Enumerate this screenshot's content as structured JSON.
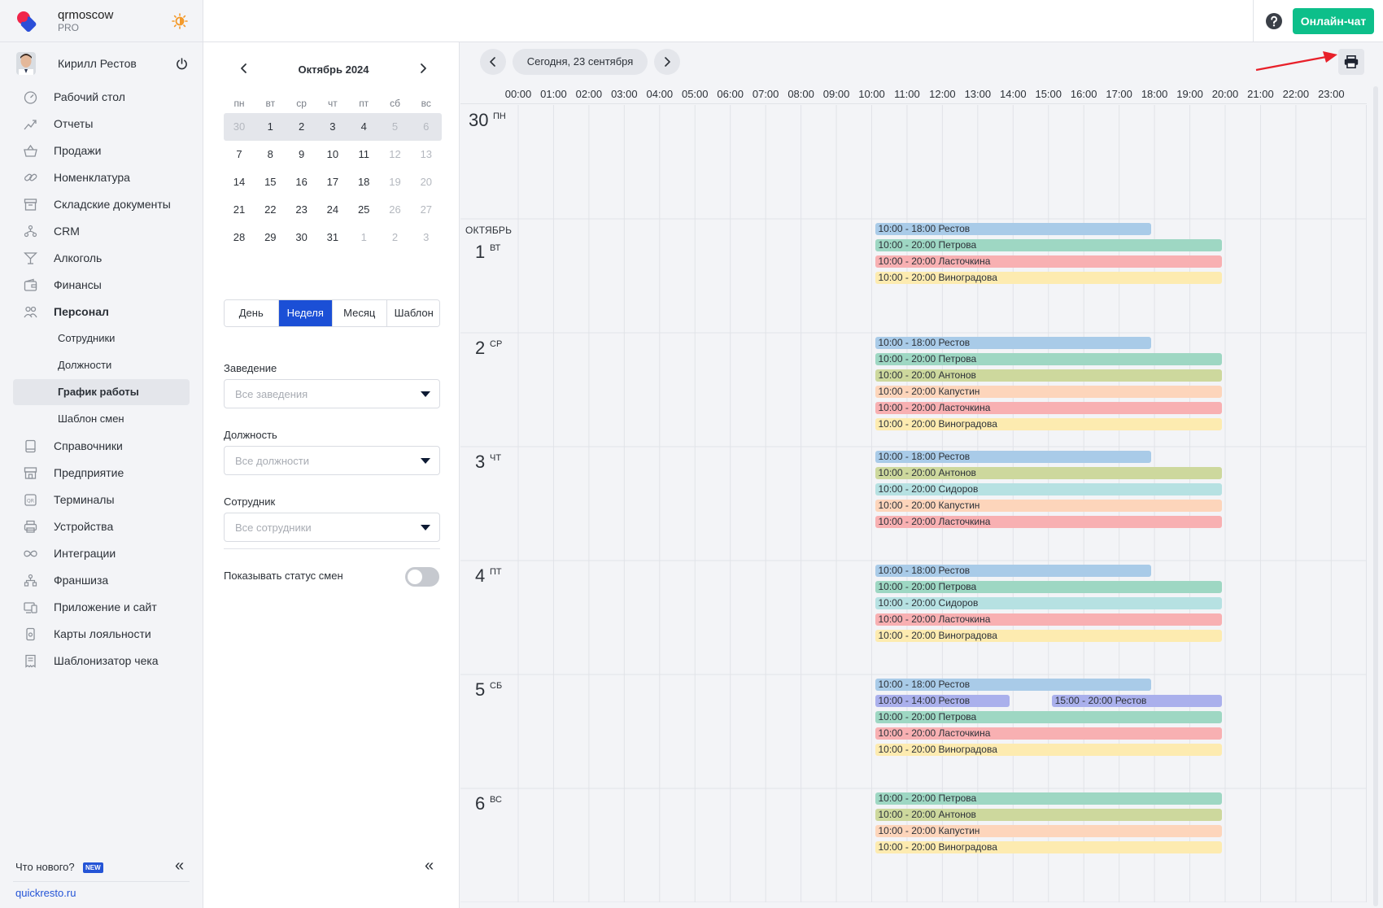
{
  "brand": {
    "name": "qrmoscow",
    "plan": "PRO"
  },
  "user": {
    "name": "Кирилл Рестов"
  },
  "nav": [
    {
      "label": "Рабочий стол",
      "icon": "dashboard-icon",
      "sub": false
    },
    {
      "label": "Отчеты",
      "icon": "reports-icon",
      "sub": false
    },
    {
      "label": "Продажи",
      "icon": "sales-basket-icon",
      "sub": false
    },
    {
      "label": "Номенклатура",
      "icon": "link-icon",
      "sub": false
    },
    {
      "label": "Складские документы",
      "icon": "warehouse-icon",
      "sub": false
    },
    {
      "label": "CRM",
      "icon": "crm-people-icon",
      "sub": false
    },
    {
      "label": "Алкоголь",
      "icon": "cocktail-icon",
      "sub": false
    },
    {
      "label": "Финансы",
      "icon": "wallet-icon",
      "sub": false
    },
    {
      "label": "Персонал",
      "icon": "staff-icon",
      "sub": false,
      "bold": true
    },
    {
      "label": "Сотрудники",
      "sub": true
    },
    {
      "label": "Должности",
      "sub": true
    },
    {
      "label": "График работы",
      "sub": true,
      "active": true
    },
    {
      "label": "Шаблон смен",
      "sub": true
    },
    {
      "label": "Справочники",
      "icon": "book-icon",
      "sub": false
    },
    {
      "label": "Предприятие",
      "icon": "store-icon",
      "sub": false
    },
    {
      "label": "Терминалы",
      "icon": "terminal-icon",
      "sub": false
    },
    {
      "label": "Устройства",
      "icon": "printer-device-icon",
      "sub": false
    },
    {
      "label": "Интеграции",
      "icon": "infinity-icon",
      "sub": false
    },
    {
      "label": "Франшиза",
      "icon": "franchise-icon",
      "sub": false
    },
    {
      "label": "Приложение и сайт",
      "icon": "app-site-icon",
      "sub": false
    },
    {
      "label": "Карты лояльности",
      "icon": "loyalty-card-icon",
      "sub": false
    },
    {
      "label": "Шаблонизатор чека",
      "icon": "receipt-icon",
      "sub": false
    }
  ],
  "footer": {
    "whats_new": "Что нового?",
    "badge": "NEW",
    "site": "quickresto.ru"
  },
  "topbar": {
    "chat_label": "Онлайн-чат"
  },
  "calendar": {
    "title": "Октябрь 2024",
    "weekdays": [
      "пн",
      "вт",
      "ср",
      "чт",
      "пт",
      "сб",
      "вс"
    ],
    "weeks": [
      [
        {
          "d": "30",
          "m": true
        },
        {
          "d": "1"
        },
        {
          "d": "2"
        },
        {
          "d": "3"
        },
        {
          "d": "4"
        },
        {
          "d": "5",
          "m": true
        },
        {
          "d": "6",
          "m": true
        }
      ],
      [
        {
          "d": "7"
        },
        {
          "d": "8"
        },
        {
          "d": "9"
        },
        {
          "d": "10"
        },
        {
          "d": "11"
        },
        {
          "d": "12",
          "m": true
        },
        {
          "d": "13",
          "m": true
        }
      ],
      [
        {
          "d": "14"
        },
        {
          "d": "15"
        },
        {
          "d": "16"
        },
        {
          "d": "17"
        },
        {
          "d": "18"
        },
        {
          "d": "19",
          "m": true
        },
        {
          "d": "20",
          "m": true
        }
      ],
      [
        {
          "d": "21"
        },
        {
          "d": "22"
        },
        {
          "d": "23"
        },
        {
          "d": "24"
        },
        {
          "d": "25"
        },
        {
          "d": "26",
          "m": true
        },
        {
          "d": "27",
          "m": true
        }
      ],
      [
        {
          "d": "28"
        },
        {
          "d": "29"
        },
        {
          "d": "30"
        },
        {
          "d": "31"
        },
        {
          "d": "1",
          "m": true
        },
        {
          "d": "2",
          "m": true
        },
        {
          "d": "3",
          "m": true
        }
      ]
    ]
  },
  "view_tabs": [
    {
      "label": "День"
    },
    {
      "label": "Неделя",
      "active": true
    },
    {
      "label": "Месяц"
    },
    {
      "label": "Шаблон"
    }
  ],
  "filters": {
    "venue_label": "Заведение",
    "venue_placeholder": "Все заведения",
    "position_label": "Должность",
    "position_placeholder": "Все должности",
    "employee_label": "Сотрудник",
    "employee_placeholder": "Все сотрудники",
    "show_status_label": "Показывать статус смен",
    "show_status": false
  },
  "schedule": {
    "today_label": "Сегодня, 23 сентября",
    "hours": [
      "00:00",
      "01:00",
      "02:00",
      "03:00",
      "04:00",
      "05:00",
      "06:00",
      "07:00",
      "08:00",
      "09:00",
      "10:00",
      "11:00",
      "12:00",
      "13:00",
      "14:00",
      "15:00",
      "16:00",
      "17:00",
      "18:00",
      "19:00",
      "20:00",
      "21:00",
      "22:00",
      "23:00"
    ],
    "colors": {
      "Рестов": "#a9cbe8",
      "Рестов2": "#aab0ec",
      "Петрова": "#9ed7c3",
      "Ласточкина": "#f8b0b2",
      "Виноградова": "#fdebb0",
      "Антонов": "#cdd89d",
      "Капустин": "#fdd5bb",
      "Сидоров": "#b6e1e2"
    },
    "days": [
      {
        "num": "30",
        "wd": "ПН",
        "month": "",
        "shifts": []
      },
      {
        "num": "1",
        "wd": "ВТ",
        "month": "ОКТЯБРЬ",
        "shifts": [
          {
            "label": "10:00 - 18:00 Рестов",
            "start": 10,
            "end": 18,
            "color": "Рестов",
            "row": 0
          },
          {
            "label": "10:00 - 20:00 Петрова",
            "start": 10,
            "end": 20,
            "color": "Петрова",
            "row": 1
          },
          {
            "label": "10:00 - 20:00 Ласточкина",
            "start": 10,
            "end": 20,
            "color": "Ласточкина",
            "row": 2
          },
          {
            "label": "10:00 - 20:00 Виноградова",
            "start": 10,
            "end": 20,
            "color": "Виноградова",
            "row": 3
          }
        ]
      },
      {
        "num": "2",
        "wd": "СР",
        "month": "",
        "shifts": [
          {
            "label": "10:00 - 18:00 Рестов",
            "start": 10,
            "end": 18,
            "color": "Рестов",
            "row": 0
          },
          {
            "label": "10:00 - 20:00 Петрова",
            "start": 10,
            "end": 20,
            "color": "Петрова",
            "row": 1
          },
          {
            "label": "10:00 - 20:00 Антонов",
            "start": 10,
            "end": 20,
            "color": "Антонов",
            "row": 2
          },
          {
            "label": "10:00 - 20:00 Капустин",
            "start": 10,
            "end": 20,
            "color": "Капустин",
            "row": 3
          },
          {
            "label": "10:00 - 20:00 Ласточкина",
            "start": 10,
            "end": 20,
            "color": "Ласточкина",
            "row": 4
          },
          {
            "label": "10:00 - 20:00 Виноградова",
            "start": 10,
            "end": 20,
            "color": "Виноградова",
            "row": 5
          }
        ]
      },
      {
        "num": "3",
        "wd": "ЧТ",
        "month": "",
        "shifts": [
          {
            "label": "10:00 - 18:00 Рестов",
            "start": 10,
            "end": 18,
            "color": "Рестов",
            "row": 0
          },
          {
            "label": "10:00 - 20:00 Антонов",
            "start": 10,
            "end": 20,
            "color": "Антонов",
            "row": 1
          },
          {
            "label": "10:00 - 20:00 Сидоров",
            "start": 10,
            "end": 20,
            "color": "Сидоров",
            "row": 2
          },
          {
            "label": "10:00 - 20:00 Капустин",
            "start": 10,
            "end": 20,
            "color": "Капустин",
            "row": 3
          },
          {
            "label": "10:00 - 20:00 Ласточкина",
            "start": 10,
            "end": 20,
            "color": "Ласточкина",
            "row": 4
          }
        ]
      },
      {
        "num": "4",
        "wd": "ПТ",
        "month": "",
        "shifts": [
          {
            "label": "10:00 - 18:00 Рестов",
            "start": 10,
            "end": 18,
            "color": "Рестов",
            "row": 0
          },
          {
            "label": "10:00 - 20:00 Петрова",
            "start": 10,
            "end": 20,
            "color": "Петрова",
            "row": 1
          },
          {
            "label": "10:00 - 20:00 Сидоров",
            "start": 10,
            "end": 20,
            "color": "Сидоров",
            "row": 2
          },
          {
            "label": "10:00 - 20:00 Ласточкина",
            "start": 10,
            "end": 20,
            "color": "Ласточкина",
            "row": 3
          },
          {
            "label": "10:00 - 20:00 Виноградова",
            "start": 10,
            "end": 20,
            "color": "Виноградова",
            "row": 4
          }
        ]
      },
      {
        "num": "5",
        "wd": "СБ",
        "month": "",
        "shifts": [
          {
            "label": "10:00 - 18:00 Рестов",
            "start": 10,
            "end": 18,
            "color": "Рестов",
            "row": 0
          },
          {
            "label": "10:00 - 14:00 Рестов",
            "start": 10,
            "end": 14,
            "color": "Рестов2",
            "row": 1
          },
          {
            "label": "15:00 - 20:00 Рестов",
            "start": 15,
            "end": 20,
            "color": "Рестов2",
            "row": 1
          },
          {
            "label": "10:00 - 20:00 Петрова",
            "start": 10,
            "end": 20,
            "color": "Петрова",
            "row": 2
          },
          {
            "label": "10:00 - 20:00 Ласточкина",
            "start": 10,
            "end": 20,
            "color": "Ласточкина",
            "row": 3
          },
          {
            "label": "10:00 - 20:00 Виноградова",
            "start": 10,
            "end": 20,
            "color": "Виноградова",
            "row": 4
          }
        ]
      },
      {
        "num": "6",
        "wd": "ВС",
        "month": "",
        "shifts": [
          {
            "label": "10:00 - 20:00 Петрова",
            "start": 10,
            "end": 20,
            "color": "Петрова",
            "row": 0
          },
          {
            "label": "10:00 - 20:00 Антонов",
            "start": 10,
            "end": 20,
            "color": "Антонов",
            "row": 1
          },
          {
            "label": "10:00 - 20:00 Капустин",
            "start": 10,
            "end": 20,
            "color": "Капустин",
            "row": 2
          },
          {
            "label": "10:00 - 20:00 Виноградова",
            "start": 10,
            "end": 20,
            "color": "Виноградова",
            "row": 3
          }
        ]
      }
    ]
  }
}
